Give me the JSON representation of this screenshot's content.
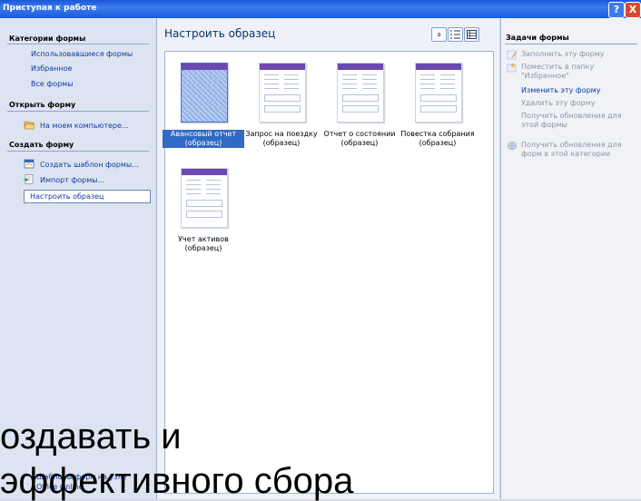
{
  "window": {
    "title": "Приступая к работе",
    "help": "?",
    "close": "X"
  },
  "left": {
    "categories_header": "Категории формы",
    "categories": [
      "Использовавшиеся формы",
      "Избранное",
      "Все формы"
    ],
    "open_header": "Открыть форму",
    "open_link": "На моем компьютере...",
    "create_header": "Создать форму",
    "create_links": [
      "Создать шаблон формы...",
      "Импорт формы...",
      "Настроить образец"
    ],
    "bottom_link": "Шаблоны форм на узле Office Online"
  },
  "center": {
    "title": "Настроить образец",
    "view_buttons": [
      "a",
      "list",
      "grid"
    ],
    "tiles": [
      {
        "label": "Авансовый отчет (образец)",
        "selected": true
      },
      {
        "label": "Запрос на поездку (образец)",
        "selected": false
      },
      {
        "label": "Отчет о состоянии (образец)",
        "selected": false
      },
      {
        "label": "Повестка собрания (образец)",
        "selected": false
      },
      {
        "label": "Учет активов (образец)",
        "selected": false
      }
    ]
  },
  "right": {
    "header": "Задачи формы",
    "tasks": [
      {
        "label": "Заполнить эту форму",
        "enabled": false
      },
      {
        "label": "Поместить в папку \"Избранное\"",
        "enabled": false
      },
      {
        "label": "Изменить эту форму",
        "enabled": true
      },
      {
        "label": "Удалить эту форму",
        "enabled": false
      },
      {
        "label": "Получить обновления для этой формы",
        "enabled": false
      },
      {
        "label": "Получить обновления для форм в этой категории",
        "enabled": false
      }
    ]
  },
  "overlay": {
    "line1": "оздавать и",
    "line2": "эффективного сбора"
  },
  "colors": {
    "titlebar": "#2a66e0",
    "link": "#0f3ca3",
    "selection": "#316ac5"
  }
}
